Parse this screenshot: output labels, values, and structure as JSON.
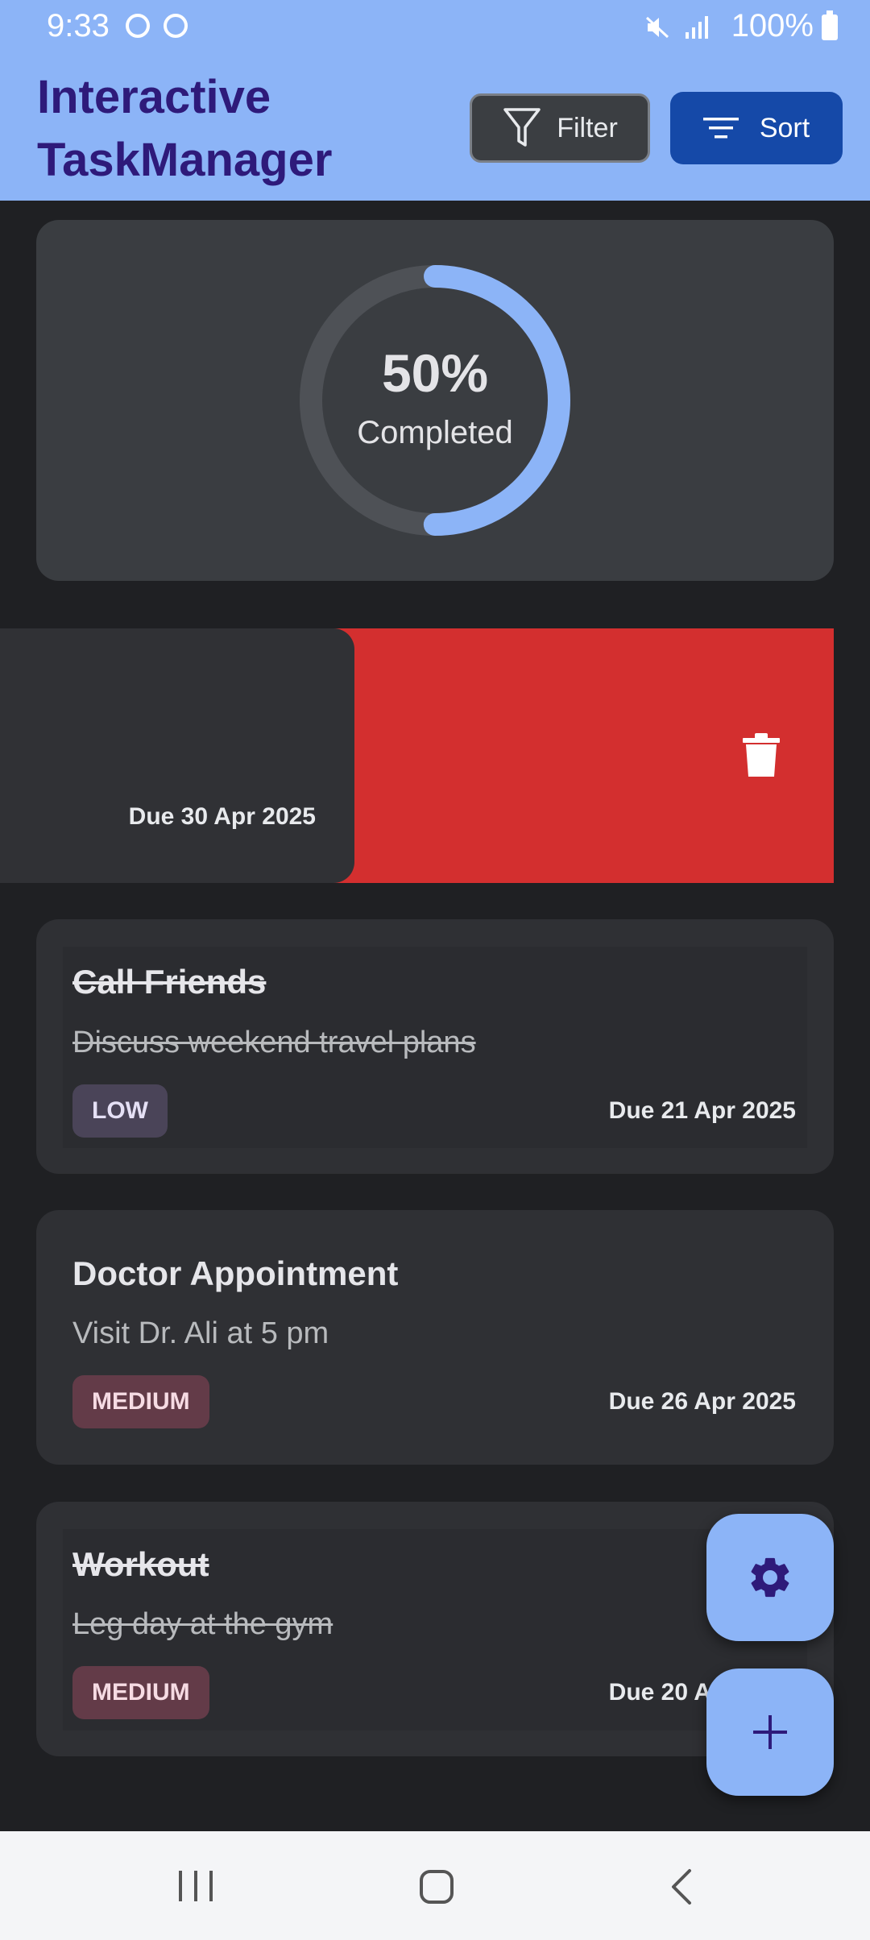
{
  "status_bar": {
    "time": "9:33",
    "battery": "100%"
  },
  "app": {
    "title": "Interactive TaskManager",
    "filter_label": "Filter",
    "sort_label": "Sort"
  },
  "progress": {
    "percent_text": "50%",
    "fraction": 0.5,
    "label": "Completed"
  },
  "swiped_task": {
    "due": "Due 30 Apr 2025"
  },
  "tasks": [
    {
      "title": "Call Friends",
      "description": "Discuss weekend travel plans",
      "priority": "LOW",
      "due": "Due 21 Apr 2025",
      "completed": true
    },
    {
      "title": "Doctor Appointment",
      "description": "Visit Dr. Ali at 5 pm",
      "priority": "MEDIUM",
      "due": "Due 26 Apr 2025",
      "completed": false
    },
    {
      "title": "Workout",
      "description": "Leg day at the gym",
      "priority": "MEDIUM",
      "due": "Due 20 Apr 2025",
      "completed": true
    }
  ],
  "colors": {
    "app_bar": "#8cb4f7",
    "accent": "#1549a8",
    "delete": "#d32f2f",
    "title_text": "#2e1a7a"
  }
}
